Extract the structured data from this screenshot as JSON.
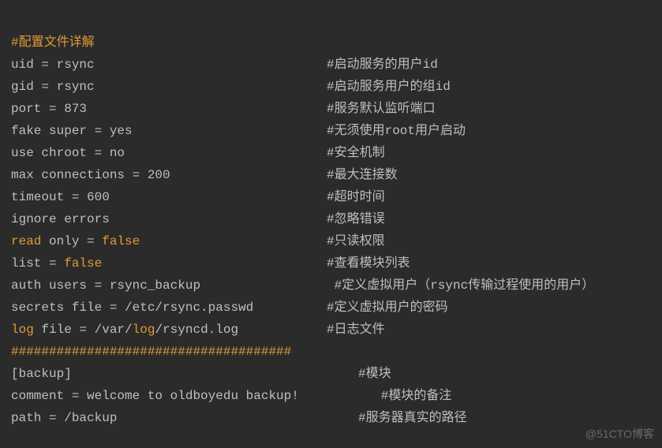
{
  "header_comment": "#配置文件详解",
  "rows": [
    {
      "left": {
        "parts": [
          {
            "t": "uid = rsync",
            "cls": "p"
          }
        ]
      },
      "right": "#启动服务的用户id"
    },
    {
      "left": {
        "parts": [
          {
            "t": "gid = rsync",
            "cls": "p"
          }
        ]
      },
      "right": "#启动服务用户的组id"
    },
    {
      "left": {
        "parts": [
          {
            "t": "port = 873",
            "cls": "p"
          }
        ]
      },
      "right": "#服务默认监听端口"
    },
    {
      "left": {
        "parts": [
          {
            "t": "fake super = yes",
            "cls": "p"
          }
        ]
      },
      "right": "#无须使用root用户启动"
    },
    {
      "left": {
        "parts": [
          {
            "t": "use chroot = no",
            "cls": "p"
          }
        ]
      },
      "right": "#安全机制"
    },
    {
      "left": {
        "parts": [
          {
            "t": "max connections = 200",
            "cls": "p"
          }
        ]
      },
      "right": "#最大连接数"
    },
    {
      "left": {
        "parts": [
          {
            "t": "timeout = 600",
            "cls": "p"
          }
        ]
      },
      "right": "#超时时间"
    },
    {
      "left": {
        "parts": [
          {
            "t": "ignore errors",
            "cls": "p"
          }
        ]
      },
      "right": "#忽略错误"
    },
    {
      "left": {
        "parts": [
          {
            "t": "read",
            "cls": "k"
          },
          {
            "t": " only = ",
            "cls": "p"
          },
          {
            "t": "false",
            "cls": "v"
          }
        ]
      },
      "right": "#只读权限"
    },
    {
      "left": {
        "parts": [
          {
            "t": "list",
            "cls": "p"
          },
          {
            "t": " = ",
            "cls": "p"
          },
          {
            "t": "false",
            "cls": "v"
          }
        ]
      },
      "right": "#查看模块列表"
    },
    {
      "left": {
        "parts": [
          {
            "t": "auth users = rsync_backup",
            "cls": "p"
          }
        ]
      },
      "right": " #定义虚拟用户（rsync传输过程使用的用户）"
    },
    {
      "left": {
        "parts": [
          {
            "t": "secrets file = /etc/rsync.passwd",
            "cls": "p"
          }
        ]
      },
      "right": "#定义虚拟用户的密码"
    },
    {
      "left": {
        "parts": [
          {
            "t": "log",
            "cls": "k"
          },
          {
            "t": " file = /var/",
            "cls": "p"
          },
          {
            "t": "log",
            "cls": "k"
          },
          {
            "t": "/rsyncd.log",
            "cls": "p"
          }
        ]
      },
      "right": "#日志文件"
    }
  ],
  "separator": "#####################################",
  "tail": [
    {
      "left": {
        "parts": [
          {
            "t": "[backup]",
            "cls": "p"
          }
        ]
      },
      "right": "#模块",
      "rightPad": "      "
    },
    {
      "left": {
        "parts": [
          {
            "t": "comment = welcome to oldboyedu backup!",
            "cls": "p"
          }
        ]
      },
      "right": "#模块的备注",
      "rightIndent": "   "
    },
    {
      "left": {
        "parts": [
          {
            "t": "path = /backup",
            "cls": "p"
          }
        ]
      },
      "right": "#服务器真实的路径"
    }
  ],
  "watermark": "@51CTO博客"
}
